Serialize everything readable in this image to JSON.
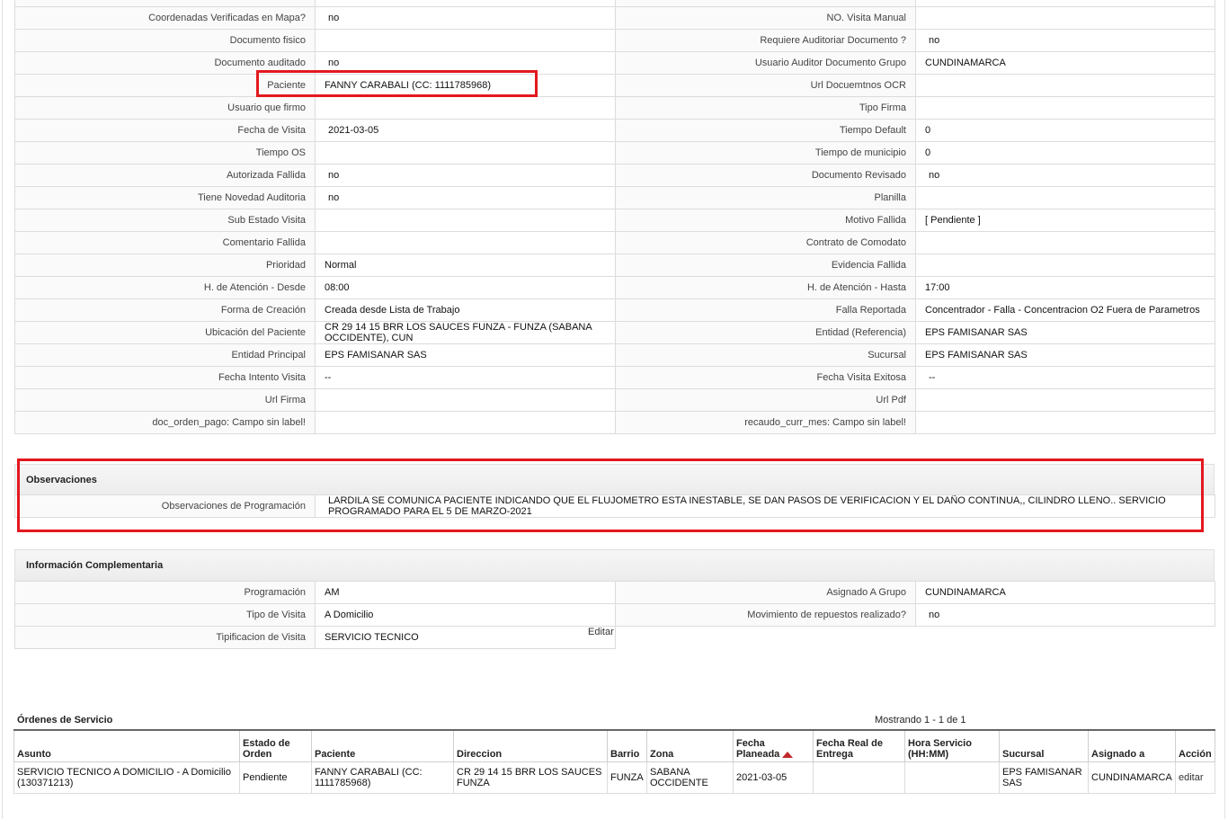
{
  "detail_rows": [
    [
      "",
      "",
      "",
      ""
    ],
    [
      "Coordenadas Verificadas en Mapa?",
      "no",
      "NO. Visita Manual",
      ""
    ],
    [
      "Documento fisico",
      "",
      "Requiere Auditoriar Documento ?",
      "no"
    ],
    [
      "Documento auditado",
      "no",
      "Usuario Auditor Documento Grupo",
      "CUNDINAMARCA"
    ],
    [
      "Paciente",
      "FANNY CARABALI (CC: 1111785968)",
      "Url Docuemtnos OCR",
      ""
    ],
    [
      "Usuario que firmo",
      "",
      "Tipo Firma",
      ""
    ],
    [
      "Fecha de Visita",
      "2021-03-05",
      "Tiempo Default",
      "0"
    ],
    [
      "Tiempo OS",
      "",
      "Tiempo de municipio",
      "0"
    ],
    [
      "Autorizada Fallida",
      "no",
      "Documento Revisado",
      "no"
    ],
    [
      "Tiene Novedad Auditoria",
      "no",
      "Planilla",
      ""
    ],
    [
      "Sub Estado Visita",
      "",
      "Motivo Fallida",
      "[ Pendiente ]"
    ],
    [
      "Comentario Fallida",
      "",
      "Contrato de Comodato",
      ""
    ],
    [
      "Prioridad",
      "Normal",
      "Evidencia Fallida",
      ""
    ],
    [
      "H. de Atención - Desde",
      "08:00",
      "H. de Atención - Hasta",
      "17:00"
    ],
    [
      "Forma de Creación",
      "Creada desde Lista de Trabajo",
      "Falla Reportada",
      "Concentrador - Falla - Concentracion O2 Fuera de Parametros"
    ],
    [
      "Ubicación del Paciente",
      "CR 29 14 15 BRR LOS SAUCES FUNZA - FUNZA (SABANA OCCIDENTE), CUN",
      "Entidad (Referencia)",
      "EPS FAMISANAR SAS"
    ],
    [
      "Entidad Principal",
      "EPS FAMISANAR SAS",
      "Sucursal",
      "EPS FAMISANAR SAS"
    ],
    [
      "Fecha Intento Visita",
      "--",
      "Fecha Visita Exitosa",
      "--"
    ],
    [
      "Url Firma",
      "",
      "Url Pdf",
      ""
    ],
    [
      "doc_orden_pago: Campo sin label!",
      "",
      "recaudo_curr_mes: Campo sin label!",
      ""
    ]
  ],
  "observaciones": {
    "title": "Observaciones",
    "label": "Observaciones de Programación",
    "value": "LARDILA SE COMUNICA PACIENTE INDICANDO QUE EL FLUJOMETRO ESTA INESTABLE, SE DAN PASOS DE VERIFICACION Y EL DAÑO CONTINUA,, CILINDRO LLENO.. SERVICIO PROGRAMADO PARA EL 5 DE MARZO-2021"
  },
  "complementaria": {
    "title": "Información Complementaria",
    "rows": [
      [
        "Programación",
        "AM",
        "Asignado A Grupo",
        "CUNDINAMARCA"
      ],
      [
        "Tipo de Visita",
        "A Domicilio",
        "Movimiento de repuestos realizado?",
        "no"
      ]
    ],
    "last_row": [
      "Tipificacion de Visita",
      "SERVICIO TECNICO"
    ],
    "edit_label": "Editar"
  },
  "orders": {
    "title": "Órdenes de Servicio",
    "count": "Mostrando 1 - 1 de 1",
    "columns": [
      "Asunto",
      "Estado de Orden",
      "Paciente",
      "Direccion",
      "Barrio",
      "Zona",
      "Fecha Planeada",
      "Fecha Real de Entrega",
      "Hora Servicio (HH:MM)",
      "Sucursal",
      "Asignado a",
      "Acción"
    ],
    "rows": [
      [
        "SERVICIO TECNICO A DOMICILIO - A Domicilio (130371213)",
        "Pendiente",
        "FANNY CARABALI (CC: 1111785968)",
        "CR 29 14 15 BRR LOS SAUCES FUNZA",
        "FUNZA",
        "SABANA OCCIDENTE",
        "2021-03-05",
        "",
        "",
        "EPS FAMISANAR SAS",
        "CUNDINAMARCA",
        "editar"
      ]
    ]
  },
  "colors": {
    "highlight": "#e3181f",
    "sort_arrow": "#c0282b"
  }
}
